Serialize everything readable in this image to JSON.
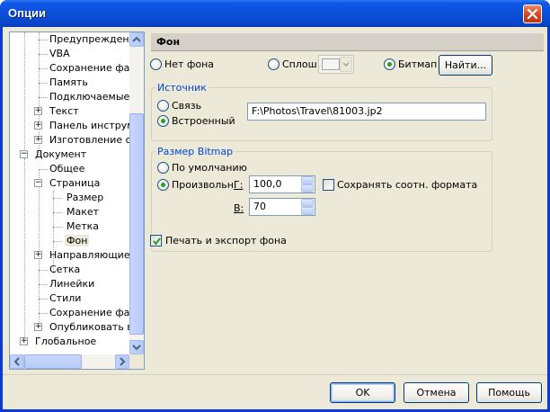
{
  "window": {
    "title": "Опции"
  },
  "tree": {
    "items": [
      {
        "label": "Предупреждения"
      },
      {
        "label": "VBA"
      },
      {
        "label": "Сохранение файл"
      },
      {
        "label": "Память"
      },
      {
        "label": "Подключаемые м"
      },
      {
        "label": "Текст"
      },
      {
        "label": "Панель инструме"
      },
      {
        "label": "Изготовление схе"
      },
      {
        "label": "Документ"
      },
      {
        "label": "Общее"
      },
      {
        "label": "Страница"
      },
      {
        "label": "Размер"
      },
      {
        "label": "Макет"
      },
      {
        "label": "Метка"
      },
      {
        "label": "Фон"
      },
      {
        "label": "Направляющие"
      },
      {
        "label": "Сетка"
      },
      {
        "label": "Линейки"
      },
      {
        "label": "Стили"
      },
      {
        "label": "Сохранение файл"
      },
      {
        "label": "Опубликовать в"
      },
      {
        "label": "Глобальное"
      }
    ]
  },
  "panel": {
    "title": "Фон",
    "bg_none": "Нет фона",
    "bg_solid": "Сплош",
    "bg_bitmap": "Битмап",
    "browse": "Найти...",
    "source": {
      "title": "Источник",
      "link": "Связь",
      "embedded": "Встроенный",
      "path": "F:\\Photos\\Travel\\81003.jp2"
    },
    "bitmap_size": {
      "title": "Размер Bitmap",
      "default": "По умолчанию",
      "custom": "Произвольн.",
      "h_label": "Г:",
      "h_value": "100,0",
      "v_label": "В:",
      "v_value": "70",
      "keep_ratio": "Сохранять соотн. формата",
      "keep_ratio_checked": false
    },
    "print_export": "Печать и экспорт фона",
    "print_export_checked": true
  },
  "buttons": {
    "ok": "OK",
    "cancel": "Отмена",
    "help": "Помощь"
  },
  "colors": {
    "title_bar": "#0a4fd8",
    "dialog_bg": "#ece9d8",
    "group_title": "#0046d5",
    "radio_dot": "#21a121"
  }
}
